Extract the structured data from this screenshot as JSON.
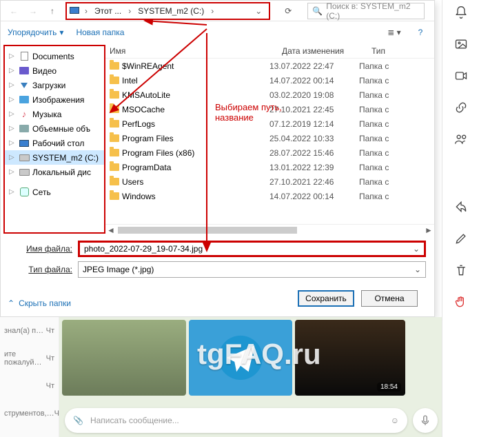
{
  "dialog": {
    "breadcrumbs": {
      "pc_icon": "pc",
      "root": "Этот ...",
      "current": "SYSTEM_m2 (C:)"
    },
    "search_placeholder": "Поиск в: SYSTEM_m2 (C:)",
    "toolbar": {
      "organize": "Упорядочить",
      "new_folder": "Новая папка"
    },
    "columns": {
      "name": "Имя",
      "date": "Дата изменения",
      "type": "Тип"
    },
    "sidebar": [
      {
        "label": "Documents",
        "icon": "doc",
        "caret": "▷"
      },
      {
        "label": "Видео",
        "icon": "video",
        "caret": "▷"
      },
      {
        "label": "Загрузки",
        "icon": "download",
        "caret": "▷"
      },
      {
        "label": "Изображения",
        "icon": "pic",
        "caret": "▷"
      },
      {
        "label": "Музыка",
        "icon": "music",
        "caret": "▷"
      },
      {
        "label": "Объемные объ",
        "icon": "3d",
        "caret": "▷"
      },
      {
        "label": "Рабочий стол",
        "icon": "desktop",
        "caret": "▷"
      },
      {
        "label": "SYSTEM_m2 (C:)",
        "icon": "drive",
        "caret": "▷",
        "selected": true
      },
      {
        "label": "Локальный дис",
        "icon": "drive",
        "caret": "▷"
      }
    ],
    "sidebar_net": {
      "label": "Сеть",
      "caret": "▷"
    },
    "files": [
      {
        "name": "$WinREAgent",
        "date": "13.07.2022 22:47",
        "type": "Папка с"
      },
      {
        "name": "Intel",
        "date": "14.07.2022 00:14",
        "type": "Папка с"
      },
      {
        "name": "KMSAutoLite",
        "date": "03.02.2020 19:08",
        "type": "Папка с"
      },
      {
        "name": "MSOCache",
        "date": "27.10.2021 22:45",
        "type": "Папка с"
      },
      {
        "name": "PerfLogs",
        "date": "07.12.2019 12:14",
        "type": "Папка с"
      },
      {
        "name": "Program Files",
        "date": "25.04.2022 10:33",
        "type": "Папка с"
      },
      {
        "name": "Program Files (x86)",
        "date": "28.07.2022 15:46",
        "type": "Папка с"
      },
      {
        "name": "ProgramData",
        "date": "13.01.2022 12:39",
        "type": "Папка с"
      },
      {
        "name": "Users",
        "date": "27.10.2021 22:46",
        "type": "Папка с"
      },
      {
        "name": "Windows",
        "date": "14.07.2022 00:14",
        "type": "Папка с"
      }
    ],
    "filename_label": "Имя файла:",
    "filename_value": "photo_2022-07-29_19-07-34.jpg",
    "filetype_label": "Тип файла:",
    "filetype_value": "JPEG Image (*.jpg)",
    "hide_folders": "Скрыть папки",
    "save": "Сохранить",
    "cancel": "Отмена"
  },
  "annotation": "Выбираем путь,\nназвание",
  "telegram": {
    "chat_items": [
      {
        "preview": "знал(а) п…",
        "time": "Чт"
      },
      {
        "preview": "ите пожалуй…",
        "time": "Чт"
      },
      {
        "preview": "",
        "time": "Чт"
      },
      {
        "preview": "струментов,…",
        "time": "Чт"
      }
    ],
    "timestamp_badge": "18:54",
    "compose_placeholder": "Написать сообщение..."
  },
  "watermark": "tgFAQ.ru"
}
